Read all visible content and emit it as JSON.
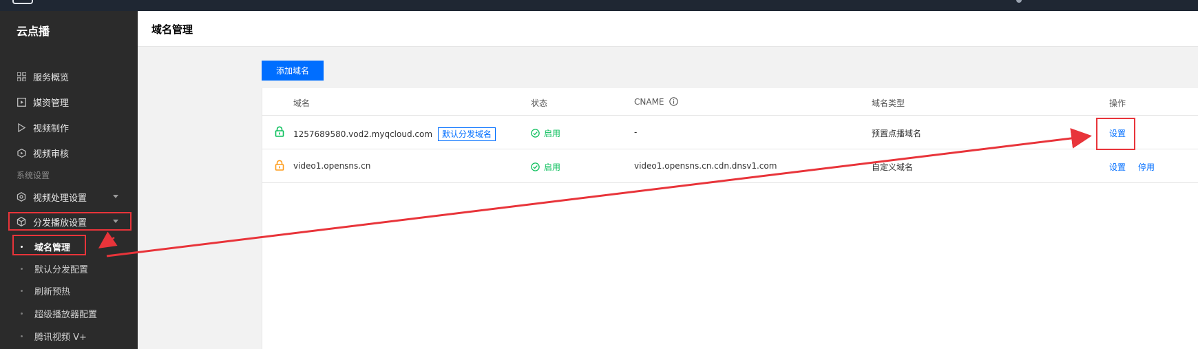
{
  "sidebar": {
    "app_title": "云点播",
    "nav": [
      {
        "label": "服务概览",
        "icon": "grid-icon"
      },
      {
        "label": "媒资管理",
        "icon": "media-icon"
      },
      {
        "label": "视频制作",
        "icon": "play-icon"
      },
      {
        "label": "视频审核",
        "icon": "review-icon"
      }
    ],
    "section_label": "系统设置",
    "settings": [
      {
        "label": "视频处理设置",
        "icon": "hexagon-gear-icon"
      },
      {
        "label": "分发播放设置",
        "icon": "cube-icon"
      }
    ],
    "sub_items": [
      {
        "label": "域名管理",
        "active": true
      },
      {
        "label": "默认分发配置",
        "active": false
      },
      {
        "label": "刷新预热",
        "active": false
      },
      {
        "label": "超级播放器配置",
        "active": false
      },
      {
        "label": "腾讯视频 V+",
        "active": false
      }
    ]
  },
  "header": {
    "title": "域名管理"
  },
  "toolbar": {
    "add_domain_label": "添加域名"
  },
  "table": {
    "columns": {
      "domain": "域名",
      "status": "状态",
      "cname": "CNAME",
      "type": "域名类型",
      "actions": "操作"
    },
    "rows": [
      {
        "domain": "1257689580.vod2.myqcloud.com",
        "tag": "默认分发域名",
        "status": "启用",
        "cname": "-",
        "type": "预置点播域名",
        "actions": [
          "设置"
        ],
        "lock_color": "#0abf5b"
      },
      {
        "domain": "video1.opensns.cn",
        "tag": "",
        "status": "启用",
        "cname": "video1.opensns.cn.cdn.dnsv1.com",
        "type": "自定义域名",
        "actions": [
          "设置",
          "停用"
        ],
        "lock_color": "#ff9c19"
      }
    ]
  },
  "colors": {
    "primary": "#006eff",
    "success": "#0abf5b",
    "annotation": "#e8343a",
    "sidebar_bg": "#2b2b2b"
  }
}
